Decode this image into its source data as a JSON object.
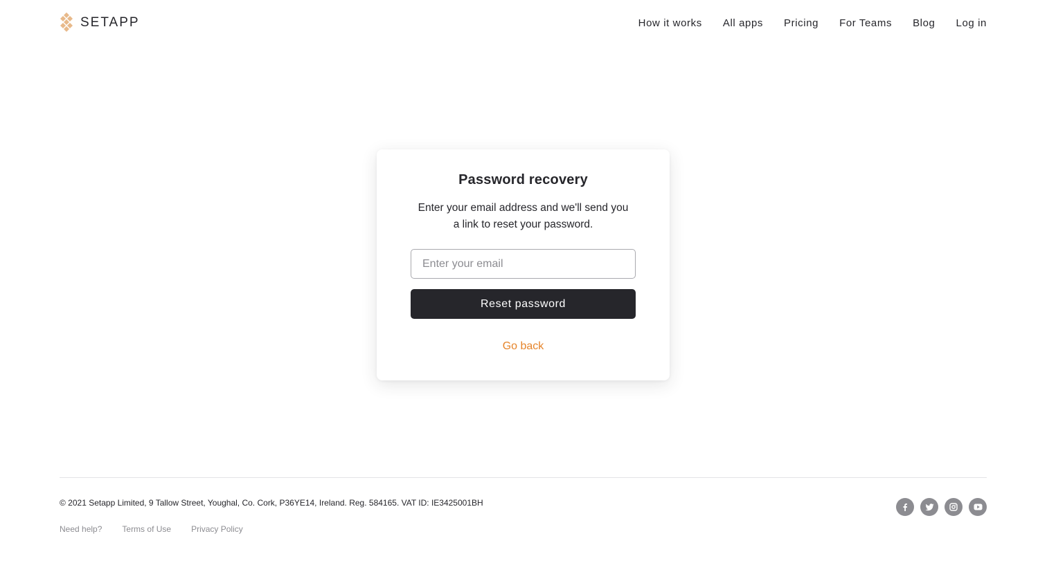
{
  "header": {
    "logo_text": "SETAPP",
    "nav": [
      {
        "label": "How it works"
      },
      {
        "label": "All apps"
      },
      {
        "label": "Pricing"
      },
      {
        "label": "For Teams"
      },
      {
        "label": "Blog"
      },
      {
        "label": "Log in"
      }
    ]
  },
  "recovery": {
    "title": "Password recovery",
    "subtitle_line1": "Enter your email address and we'll send you",
    "subtitle_line2": "a link to reset your password.",
    "email_value": "",
    "email_placeholder": "Enter your email",
    "submit_label": "Reset password",
    "back_label": "Go back"
  },
  "footer": {
    "copyright": "© 2021 Setapp Limited, 9 Tallow Street, Youghal, Co. Cork, P36YE14, Ireland. Reg. 584165. VAT ID: IE3425001BH",
    "links": [
      {
        "label": "Need help?"
      },
      {
        "label": "Terms of Use"
      },
      {
        "label": "Privacy Policy"
      }
    ],
    "social": [
      {
        "icon": "facebook-icon"
      },
      {
        "icon": "twitter-icon"
      },
      {
        "icon": "instagram-icon"
      },
      {
        "icon": "youtube-icon"
      }
    ]
  },
  "colors": {
    "text": "#26262b",
    "accent": "#e6842a",
    "logo": "#e8b98a",
    "muted": "#8c8c91",
    "button_bg": "#26262b"
  }
}
